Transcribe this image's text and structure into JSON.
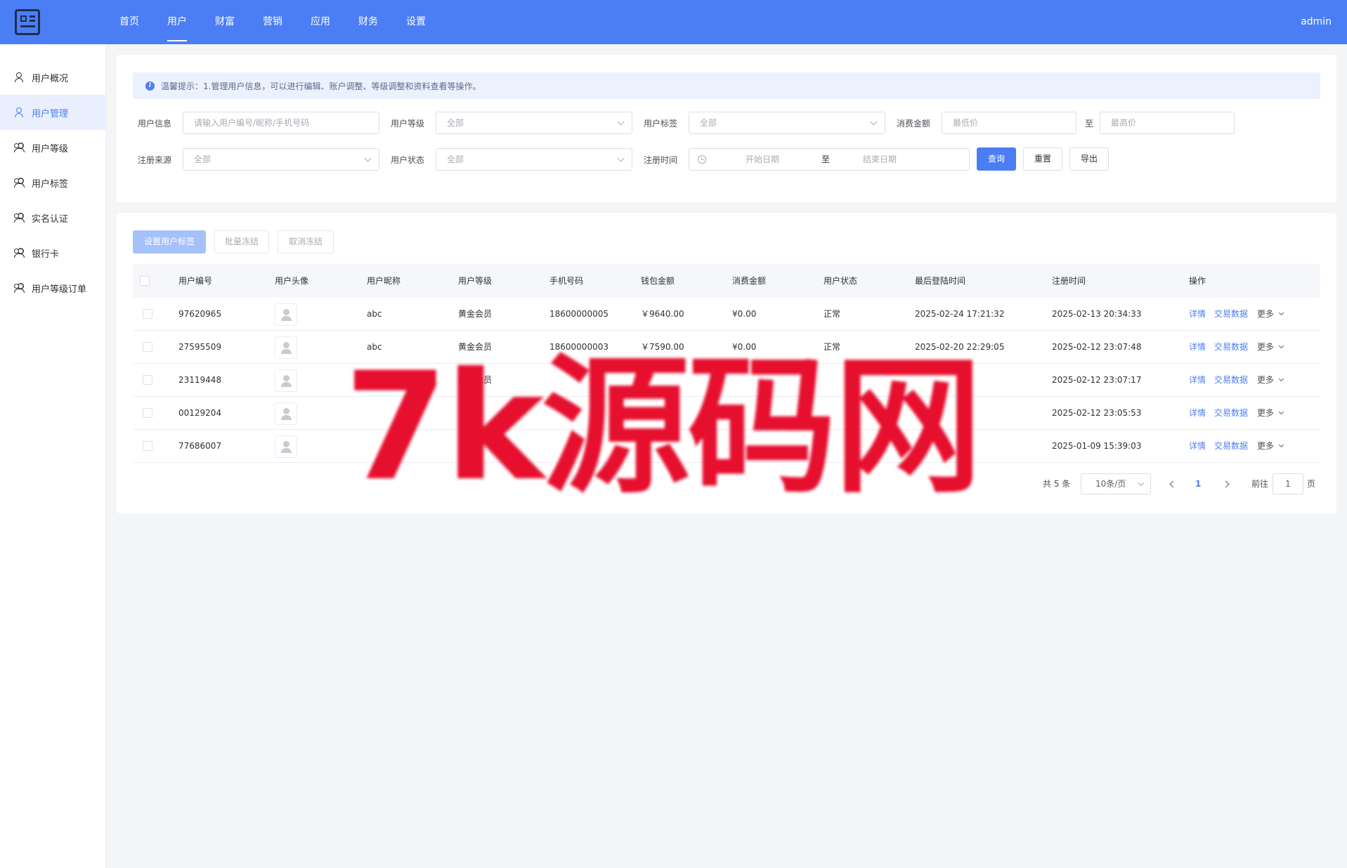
{
  "header": {
    "nav": [
      "首页",
      "用户",
      "财富",
      "营销",
      "应用",
      "财务",
      "设置"
    ],
    "active_nav": "用户",
    "user": "admin",
    "logo_icon": "id-card-icon",
    "accent": "#4b7ef5"
  },
  "sidebar": {
    "items": [
      {
        "label": "用户概况",
        "icon": "user-icon"
      },
      {
        "label": "用户管理",
        "icon": "user-manage-icon"
      },
      {
        "label": "用户等级",
        "icon": "users-icon"
      },
      {
        "label": "用户标签",
        "icon": "user-tag-icon"
      },
      {
        "label": "实名认证",
        "icon": "user-verify-icon"
      },
      {
        "label": "银行卡",
        "icon": "bank-card-icon"
      },
      {
        "label": "用户等级订单",
        "icon": "users-order-icon"
      }
    ],
    "active": "用户管理"
  },
  "tip": "温馨提示：1.管理用户信息，可以进行编辑、账户调整、等级调整和资料查看等操作。",
  "filters": {
    "user_info": {
      "label": "用户信息",
      "placeholder": "请输入用户编号/昵称/手机号码"
    },
    "user_level": {
      "label": "用户等级",
      "value": "全部"
    },
    "user_tag": {
      "label": "用户标签",
      "value": "全部"
    },
    "spend": {
      "label": "消费金额",
      "min_placeholder": "最低价",
      "sep": "至",
      "max_placeholder": "最高价"
    },
    "source": {
      "label": "注册来源",
      "value": "全部"
    },
    "status": {
      "label": "用户状态",
      "value": "全部"
    },
    "reg_time": {
      "label": "注册时间",
      "start_placeholder": "开始日期",
      "sep": "至",
      "end_placeholder": "结束日期"
    },
    "query_btn": "查询",
    "reset_btn": "重置",
    "export_btn": "导出"
  },
  "actions": {
    "set_tag": "设置用户标签",
    "batch_freeze": "批量冻结",
    "unfreeze": "取消冻结"
  },
  "table": {
    "columns": [
      "用户编号",
      "用户头像",
      "用户昵称",
      "用户等级",
      "手机号码",
      "钱包金额",
      "消费金额",
      "用户状态",
      "最后登陆时间",
      "注册时间",
      "操作"
    ],
    "rows": [
      {
        "id": "97620965",
        "nickname": "abc",
        "level": "黄金会员",
        "phone": "18600000005",
        "wallet": "￥9640.00",
        "spend": "¥0.00",
        "status": "正常",
        "last_login": "2025-02-24 17:21:32",
        "reg_time": "2025-02-13 20:34:33"
      },
      {
        "id": "27595509",
        "nickname": "abc",
        "level": "黄金会员",
        "phone": "18600000003",
        "wallet": "￥7590.00",
        "spend": "¥0.00",
        "status": "正常",
        "last_login": "2025-02-20 22:29:05",
        "reg_time": "2025-02-12 23:07:48"
      },
      {
        "id": "23119448",
        "nickname": "18600000002",
        "level": "普通会员",
        "phone": "",
        "wallet": "",
        "spend": "",
        "status": "",
        "last_login": "",
        "reg_time": "2025-02-12 23:07:17"
      },
      {
        "id": "00129204",
        "nickname": "",
        "level": "",
        "phone": "",
        "wallet": "",
        "spend": "",
        "status": "",
        "last_login": "",
        "reg_time": "2025-02-12 23:05:53"
      },
      {
        "id": "77686007",
        "nickname": "",
        "level": "",
        "phone": "",
        "wallet": "",
        "spend": "",
        "status": "",
        "last_login": "",
        "reg_time": "2025-01-09 15:39:03"
      }
    ],
    "op_detail": "详情",
    "op_trade": "交易数据",
    "op_more": "更多"
  },
  "pagination": {
    "total": "共 5 条",
    "page_size": "10条/页",
    "current": "1",
    "goto_label": "前往",
    "goto_value": "1",
    "page_suffix": "页"
  },
  "watermark": "7k源码网"
}
